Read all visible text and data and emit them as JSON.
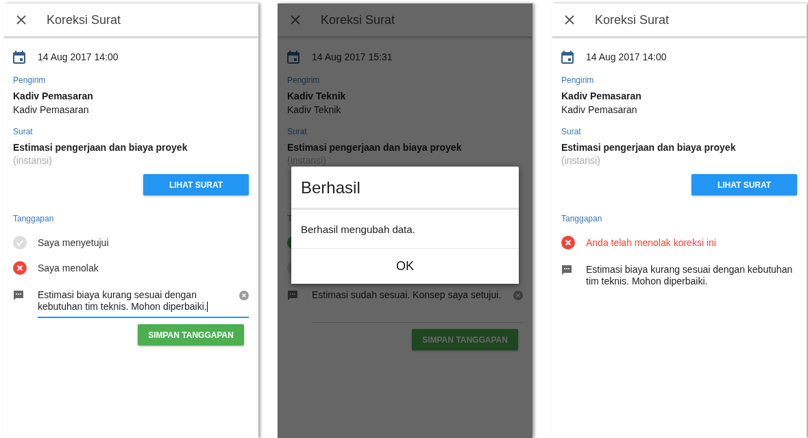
{
  "screens": [
    {
      "title": "Koreksi Surat",
      "date": "14 Aug 2017 14:00",
      "sender": {
        "label": "Pengirim",
        "name": "Kadiv Pemasaran",
        "role": "Kadiv Pemasaran"
      },
      "letter": {
        "label": "Surat",
        "title": "Estimasi pengerjaan dan biaya proyek",
        "note": "(instansi)"
      },
      "view_button": {
        "label": "LIHAT SURAT"
      },
      "response": {
        "label": "Tanggapan",
        "kind": "choice",
        "options": [
          {
            "kind": "approve",
            "label": "Saya menyetujui",
            "selected": false
          },
          {
            "kind": "reject",
            "label": "Saya menolak",
            "selected": true
          }
        ]
      },
      "comment": {
        "kind": "editing",
        "value": "Estimasi biaya kurang sesuai dengan kebutuhan tim teknis. Mohon diperbaiki."
      },
      "save_button": "SIMPAN TANGGAPAN"
    },
    {
      "title": "Koreksi Surat",
      "date": "14 Aug 2017 15:31",
      "sender": {
        "label": "Pengirim",
        "name": "Kadiv Teknik",
        "role": "Kadiv Teknik"
      },
      "letter": {
        "label": "Surat",
        "title": "Estimasi pengerjaan dan biaya proyek",
        "note": "(instansi)"
      },
      "response": {
        "label": "T",
        "kind": "choice",
        "options": [
          {
            "kind": "approve",
            "selected": true
          },
          {
            "kind": "reject",
            "selected": false
          }
        ]
      },
      "comment": {
        "kind": "idle",
        "value": "Estimasi sudah sesuai. Konsep saya setujui."
      },
      "save_button": "SIMPAN TANGGAPAN",
      "dimmed": true,
      "dialog": {
        "title": "Berhasil",
        "message": "Berhasil mengubah data.",
        "button": "OK"
      }
    },
    {
      "title": "Koreksi Surat",
      "date": "14 Aug 2017 14:00",
      "sender": {
        "label": "Pengirim",
        "name": "Kadiv Pemasaran",
        "role": "Kadiv Pemasaran"
      },
      "letter": {
        "label": "Surat",
        "title": "Estimasi pengerjaan dan biaya proyek",
        "note": "(instansi)"
      },
      "view_button": {
        "label": "LIHAT SURAT"
      },
      "response": {
        "label": "Tanggapan",
        "kind": "result",
        "status": {
          "kind": "reject",
          "text": "Anda telah menolak koreksi ini"
        }
      },
      "comment": {
        "kind": "readonly",
        "value": "Estimasi biaya kurang sesuai dengan kebutuhan tim teknis. Mohon diperbaiki."
      }
    }
  ]
}
